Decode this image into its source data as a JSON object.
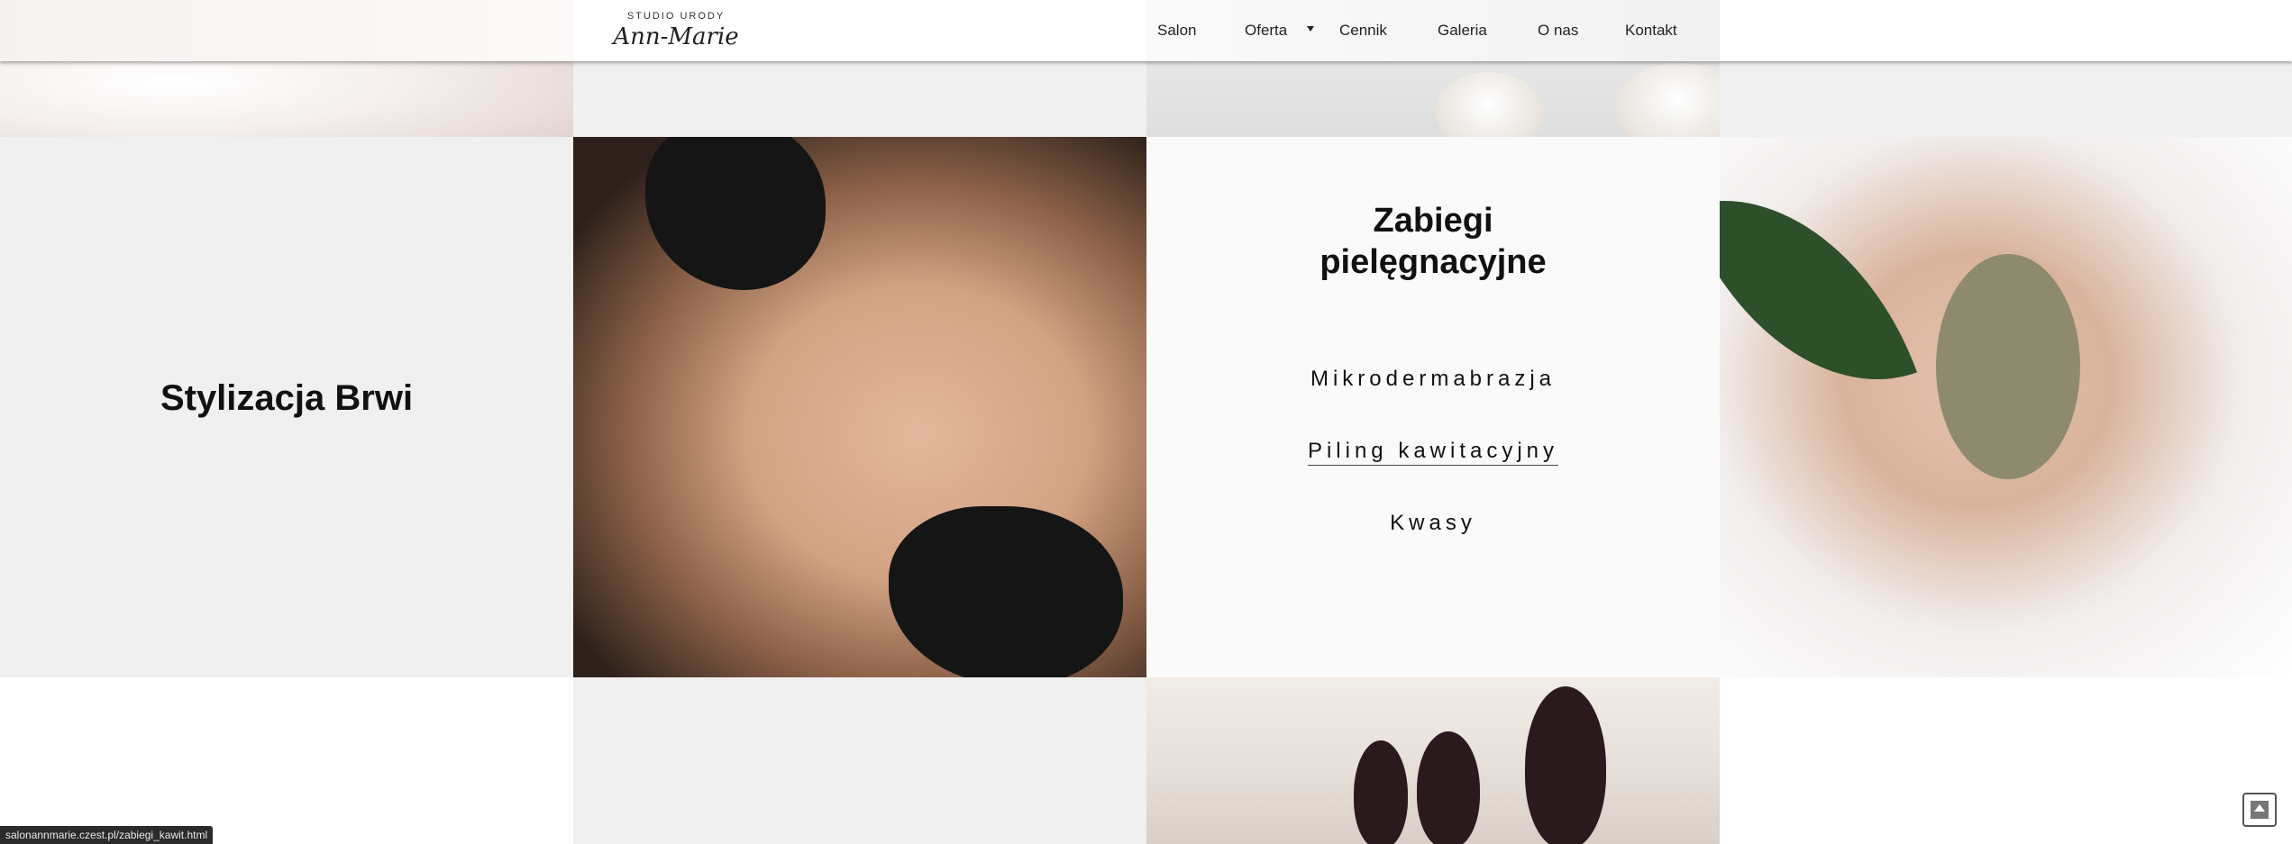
{
  "header": {
    "logo_top": "STUDIO URODY",
    "logo_script": "Ann-Marie",
    "nav": {
      "salon": "Salon",
      "oferta": "Oferta",
      "cennik": "Cennik",
      "galeria": "Galeria",
      "onas": "O nas",
      "kontakt": "Kontakt"
    }
  },
  "sections": {
    "brwi_title": "Stylizacja Brwi",
    "zabiegi_title_line1": "Zabiegi",
    "zabiegi_title_line2": "pielęgnacyjne",
    "treatments": [
      "Mikrodermabrazja",
      "Piling kawitacyjny",
      "Kwasy"
    ]
  },
  "status_bar": {
    "url": "salonannmarie.czest.pl/zabiegi_kawit.html"
  },
  "colors": {
    "grey_cell": "#f0f0f0",
    "header_bg": "#ffffff",
    "text": "#111111"
  },
  "icons": {
    "scroll_top": "scroll-to-top-icon",
    "dropdown": "chevron-down-icon"
  }
}
